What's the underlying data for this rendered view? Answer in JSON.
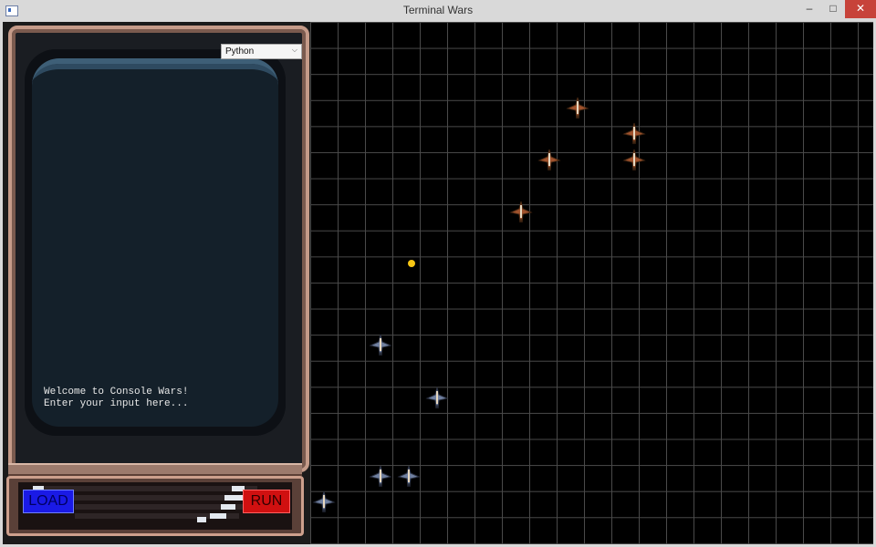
{
  "window": {
    "title": "Terminal Wars",
    "minimize": "–",
    "maximize": "□",
    "close": "✕"
  },
  "console": {
    "language": "Python",
    "lines": "Welcome to Console Wars!\nEnter your input here..."
  },
  "buttons": {
    "load": "LOAD",
    "run": "RUN"
  },
  "colors": {
    "enemy": "#a0522d",
    "player": "#7080a0",
    "target": "#f7c614",
    "grid": "#4a4a4a"
  },
  "battlefield": {
    "grid_columns": 20,
    "grid_rows": 20,
    "enemy_ships": [
      {
        "col": 9.5,
        "row": 3.3
      },
      {
        "col": 11.5,
        "row": 4.3
      },
      {
        "col": 8.5,
        "row": 5.3
      },
      {
        "col": 11.5,
        "row": 5.3
      },
      {
        "col": 7.5,
        "row": 7.3
      }
    ],
    "player_ships": [
      {
        "col": 2.5,
        "row": 12.4
      },
      {
        "col": 4.5,
        "row": 14.4
      },
      {
        "col": 2.5,
        "row": 17.4
      },
      {
        "col": 3.5,
        "row": 17.4
      },
      {
        "col": 0.5,
        "row": 18.4
      }
    ],
    "target": {
      "col": 3.6,
      "row": 9.25
    }
  }
}
